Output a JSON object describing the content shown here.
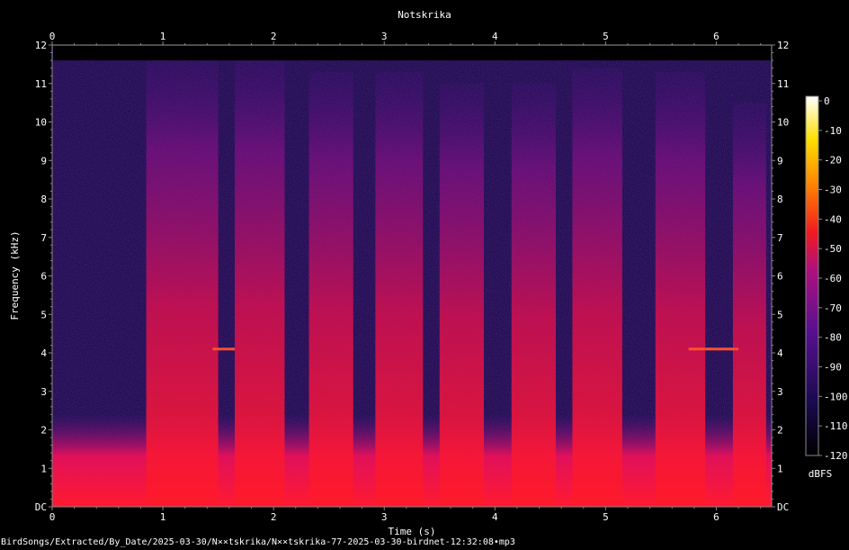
{
  "chart_data": {
    "type": "heatmap",
    "title": "Notskrika",
    "xlabel": "Time (s)",
    "ylabel": "Frequency (kHz)",
    "xlim": [
      0,
      6.5
    ],
    "ylim": [
      0,
      12
    ],
    "x_ticks": [
      "0",
      "1",
      "2",
      "3",
      "4",
      "5",
      "6"
    ],
    "y_ticks": [
      "DC",
      "1",
      "2",
      "3",
      "4",
      "5",
      "6",
      "7",
      "8",
      "9",
      "10",
      "11",
      "12"
    ],
    "colorbar": {
      "label": "dBFS",
      "ticks": [
        "0",
        "-10",
        "-20",
        "-30",
        "-40",
        "-50",
        "-60",
        "-70",
        "-80",
        "-90",
        "-100",
        "-110",
        "-120"
      ],
      "range": [
        -120,
        0
      ],
      "colors": [
        "#000000",
        "#1a0a50",
        "#5a1090",
        "#b0107e",
        "#f01a20",
        "#ff8000",
        "#ffe000",
        "#ffffff"
      ]
    },
    "calls": [
      {
        "start": 0.85,
        "end": 1.5,
        "top_khz": 11.6,
        "peak_dbfs": -48
      },
      {
        "start": 1.65,
        "end": 2.1,
        "top_khz": 11.6,
        "peak_dbfs": -50
      },
      {
        "start": 2.32,
        "end": 2.72,
        "top_khz": 11.3,
        "peak_dbfs": -55
      },
      {
        "start": 2.92,
        "end": 3.35,
        "top_khz": 11.3,
        "peak_dbfs": -54
      },
      {
        "start": 3.5,
        "end": 3.9,
        "top_khz": 11.0,
        "peak_dbfs": -56
      },
      {
        "start": 4.15,
        "end": 4.55,
        "top_khz": 11.0,
        "peak_dbfs": -55
      },
      {
        "start": 4.7,
        "end": 5.15,
        "top_khz": 11.4,
        "peak_dbfs": -50
      },
      {
        "start": 5.45,
        "end": 5.9,
        "top_khz": 11.3,
        "peak_dbfs": -52
      },
      {
        "start": 6.15,
        "end": 6.45,
        "top_khz": 10.5,
        "peak_dbfs": -58
      }
    ],
    "tones": [
      {
        "start": 1.45,
        "end": 1.65,
        "khz": 4.1
      },
      {
        "start": 5.75,
        "end": 6.2,
        "khz": 4.1
      }
    ]
  },
  "footer": "BirdSongs/Extracted/By_Date/2025-03-30/N××tskrika/N××tskrika-77-2025-03-30-birdnet-12:32:08•mp3"
}
